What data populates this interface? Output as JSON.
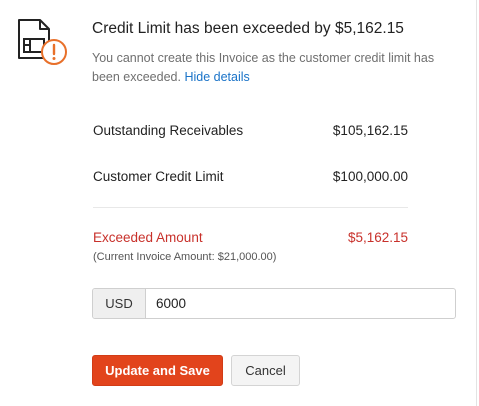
{
  "dialog": {
    "title": "Credit Limit has been exceeded by $5,162.15",
    "message": "You cannot create this Invoice as the customer credit limit has been exceeded.",
    "hide_details_link": "Hide details",
    "icon": "invoice-warning-icon"
  },
  "details": {
    "outstanding_label": "Outstanding Receivables",
    "outstanding_value": "$105,162.15",
    "credit_limit_label": "Customer Credit Limit",
    "credit_limit_value": "$100,000.00",
    "exceeded_label": "Exceeded Amount",
    "exceeded_value": "$5,162.15",
    "current_invoice_note": "(Current Invoice Amount: $21,000.00)"
  },
  "credit_input": {
    "currency": "USD",
    "value": "6000"
  },
  "buttons": {
    "update_label": "Update and Save",
    "cancel_label": "Cancel"
  },
  "colors": {
    "accent": "#e2441c",
    "warning": "#e8702a",
    "exceeded": "#c8312b",
    "link": "#1a73c8"
  }
}
